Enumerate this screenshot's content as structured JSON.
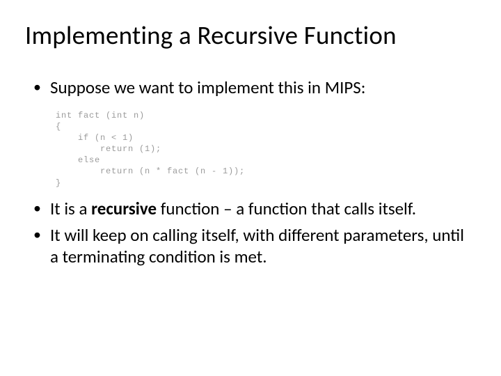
{
  "title": "Implementing a Recursive Function",
  "bullets": {
    "b1": "Suppose we want to implement this in MIPS:",
    "b2_pre": "It is a ",
    "b2_bold": "recursive",
    "b2_post": " function – a function that calls itself.",
    "b3": "It will keep on calling itself, with different parameters, until a terminating condition is met."
  },
  "code": "int fact (int n)\n{\n    if (n < 1)\n        return (1);\n    else\n        return (n * fact (n - 1));\n}"
}
